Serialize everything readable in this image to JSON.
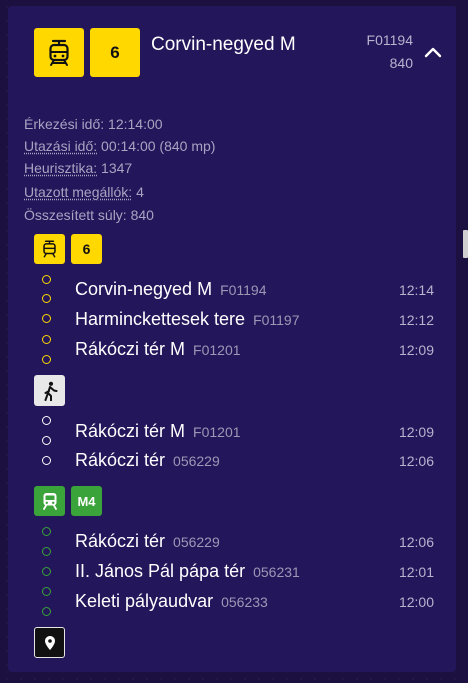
{
  "header": {
    "route_number": "6",
    "title": "Corvin-negyed M",
    "stop_code": "F01194",
    "weight": "840",
    "icons": [
      "tram-icon",
      "chevron-up-icon"
    ]
  },
  "summary": [
    {
      "label": "Érkezési idő:",
      "value": "12:14:00"
    },
    {
      "label": "Utazási idő:",
      "value": "00:14:00 (840 mp)"
    },
    {
      "label": "Heurisztika:",
      "value": "1347"
    },
    {
      "label": "Utazott megállók:",
      "value": "4"
    },
    {
      "label": "Összesített súly:",
      "value": "840"
    }
  ],
  "legs": [
    {
      "mode": "tram",
      "route": "6",
      "color": "#ffd800",
      "stops": [
        {
          "name": "Corvin-negyed M",
          "code": "F01194",
          "time": "12:14"
        },
        {
          "name": "Harminckettesek tere",
          "code": "F01197",
          "time": "12:12"
        },
        {
          "name": "Rákóczi tér M",
          "code": "F01201",
          "time": "12:09"
        }
      ]
    },
    {
      "mode": "walk",
      "color": "#ffffff",
      "stops": [
        {
          "name": "Rákóczi tér M",
          "code": "F01201",
          "time": "12:09"
        },
        {
          "name": "Rákóczi tér",
          "code": "056229",
          "time": "12:06"
        }
      ]
    },
    {
      "mode": "metro",
      "route": "M4",
      "color": "#3aa33a",
      "stops": [
        {
          "name": "Rákóczi tér",
          "code": "056229",
          "time": "12:06"
        },
        {
          "name": "II. János Pál pápa tér",
          "code": "056231",
          "time": "12:01"
        },
        {
          "name": "Keleti pályaudvar",
          "code": "056233",
          "time": "12:00"
        }
      ]
    }
  ],
  "footer_icon": "map-pin-icon"
}
